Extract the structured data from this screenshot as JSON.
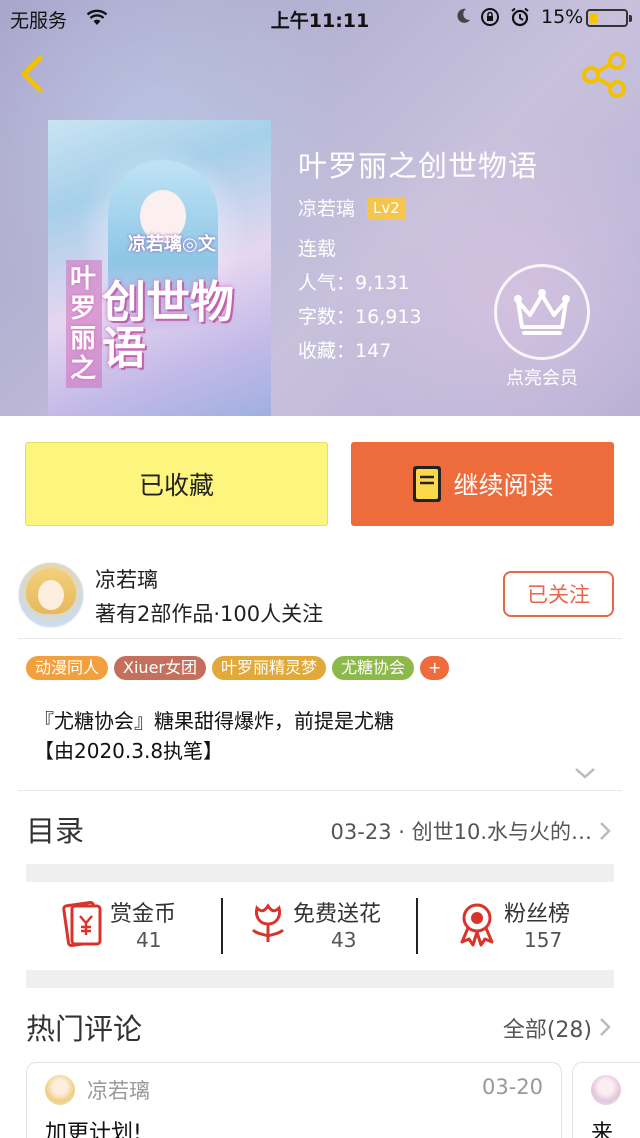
{
  "status_bar": {
    "carrier": "无服务",
    "time": "上午11:11",
    "battery_percent": "15%",
    "battery_level": 0.15,
    "icons": [
      "wifi-icon",
      "moon-icon",
      "rotation-lock-icon",
      "alarm-icon",
      "battery-icon"
    ]
  },
  "header": {
    "back_icon": "chevron-left-icon",
    "share_icon": "share-icon",
    "icon_color": "#f2c200"
  },
  "book": {
    "title": "叶罗丽之创世物语",
    "author": "凉若璃",
    "level": "Lv2",
    "status": "连载",
    "popularity_label": "人气：",
    "popularity": "9,131",
    "word_count_label": "字数：",
    "word_count": "16,913",
    "favorites_label": "收藏：",
    "favorites": "147",
    "cover_text_main": "创世物语",
    "cover_text_side": "叶罗丽之",
    "cover_text_top": "凉若璃◎文"
  },
  "vip": {
    "label": "点亮会员",
    "icon": "crown-icon"
  },
  "actions": {
    "favorite_label": "已收藏",
    "read_label": "继续阅读",
    "favorite_color": "#fdf57d",
    "read_color": "#ee6b3b"
  },
  "author_info": {
    "name": "凉若璃",
    "summary": "著有2部作品·100人关注",
    "follow_label": "已关注",
    "accent_color": "#e8674a"
  },
  "tags": [
    {
      "label": "动漫同人",
      "color": "#f2a03d"
    },
    {
      "label": "Xiuer女团",
      "color": "#c4705c"
    },
    {
      "label": "叶罗丽精灵梦",
      "color": "#e0a93a"
    },
    {
      "label": "尤糖协会",
      "color": "#8db84a"
    },
    {
      "label": "+",
      "color": "#ee6b3b"
    }
  ],
  "description": {
    "line1": "『尤糖协会』糖果甜得爆炸，前提是尤糖",
    "line2": "【由2020.3.8执笔】"
  },
  "toc": {
    "label": "目录",
    "latest": "03-23 · 创世10.水与火的…"
  },
  "stats": [
    {
      "label": "赏金币",
      "value": "41",
      "icon": "red-envelope-icon"
    },
    {
      "label": "免费送花",
      "value": "43",
      "icon": "flower-icon"
    },
    {
      "label": "粉丝榜",
      "value": "157",
      "icon": "ribbon-badge-icon"
    }
  ],
  "comments": {
    "label": "热门评论",
    "all_label": "全部(28)",
    "items": [
      {
        "author": "凉若璃",
        "date": "03-20",
        "text": "加更计划!"
      },
      {
        "author": "",
        "date": "",
        "text": "来"
      }
    ]
  }
}
